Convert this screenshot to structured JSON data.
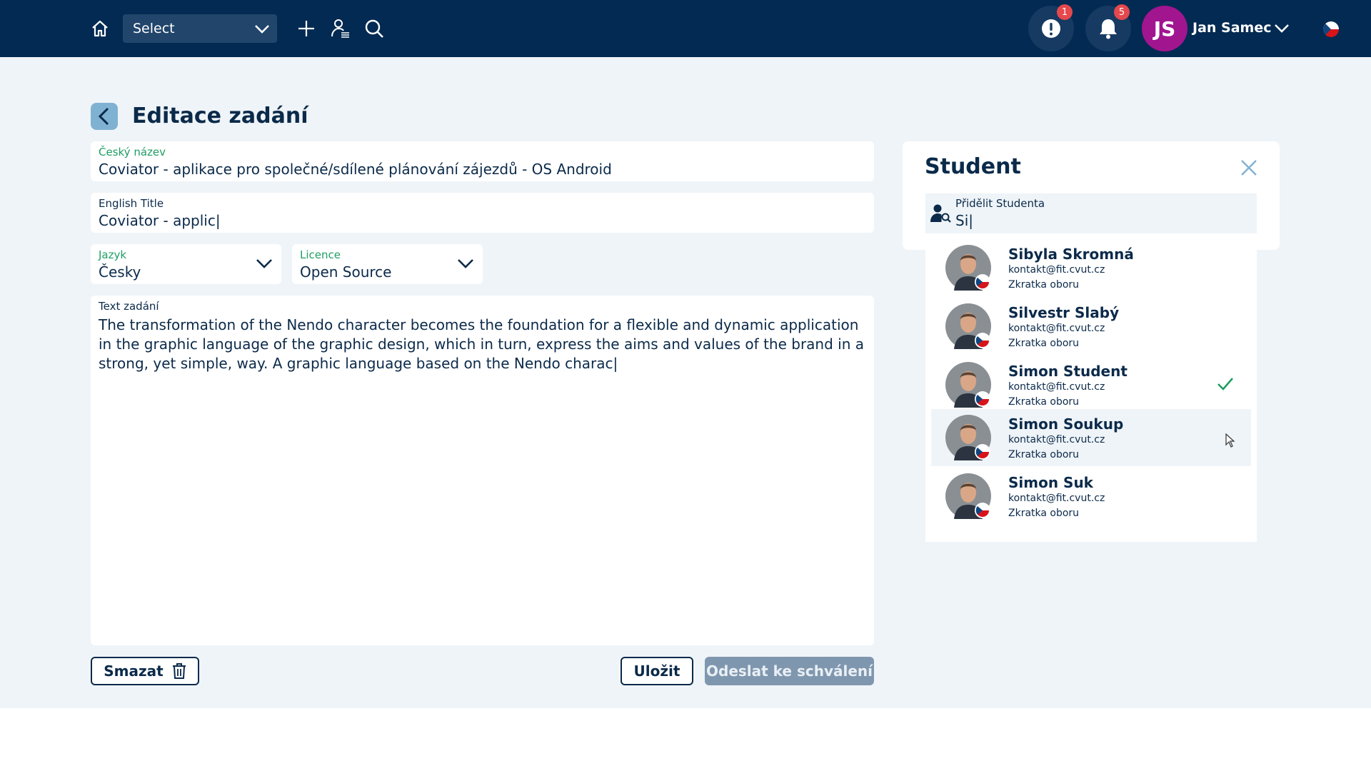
{
  "header": {
    "select_label": "Select",
    "user_initials": "JS",
    "user_name": "Jan Samec",
    "alert_count": "1",
    "notification_count": "5"
  },
  "page": {
    "title": "Editace zadání"
  },
  "form": {
    "czech_title_label": "Český název",
    "czech_title_value": "Coviator - aplikace pro společné/sdílené plánování zájezdů - OS Android",
    "english_title_label": "English Title",
    "english_title_value": "Coviator - applic|",
    "language_label": "Jazyk",
    "language_value": "Česky",
    "license_label": "Licence",
    "license_value": "Open Source",
    "text_label": "Text zadání",
    "text_value": "The transformation of the Nendo character becomes the foundation for a flexible and dynamic application in the graphic language of the graphic design, which in turn, express the aims and values of the brand in a strong, yet simple, way. A graphic language based on the Nendo charac|"
  },
  "actions": {
    "delete_label": "Smazat",
    "save_label": "Uložit",
    "submit_label": "Odeslat ke schválení"
  },
  "student_panel": {
    "title": "Student",
    "search_label": "Přidělit Studenta",
    "search_value": "Si|",
    "options": [
      {
        "name": "Sibyla Skromná",
        "email": "kontakt@fit.cvut.cz",
        "field": "Zkratka oboru"
      },
      {
        "name": "Silvestr Slabý",
        "email": "kontakt@fit.cvut.cz",
        "field": "Zkratka oboru"
      },
      {
        "name": "Simon Student",
        "email": "kontakt@fit.cvut.cz",
        "field": "Zkratka oboru"
      },
      {
        "name": "Simon Soukup",
        "email": "kontakt@fit.cvut.cz",
        "field": "Zkratka oboru"
      },
      {
        "name": "Simon Suk",
        "email": "kontakt@fit.cvut.cz",
        "field": "Zkratka oboru"
      }
    ]
  },
  "colors": {
    "header_bg": "#032a52",
    "page_bg": "#eff4f8",
    "accent_green": "#1f9e63",
    "avatar_purple": "#a1158f",
    "badge_red": "#e5484d"
  }
}
